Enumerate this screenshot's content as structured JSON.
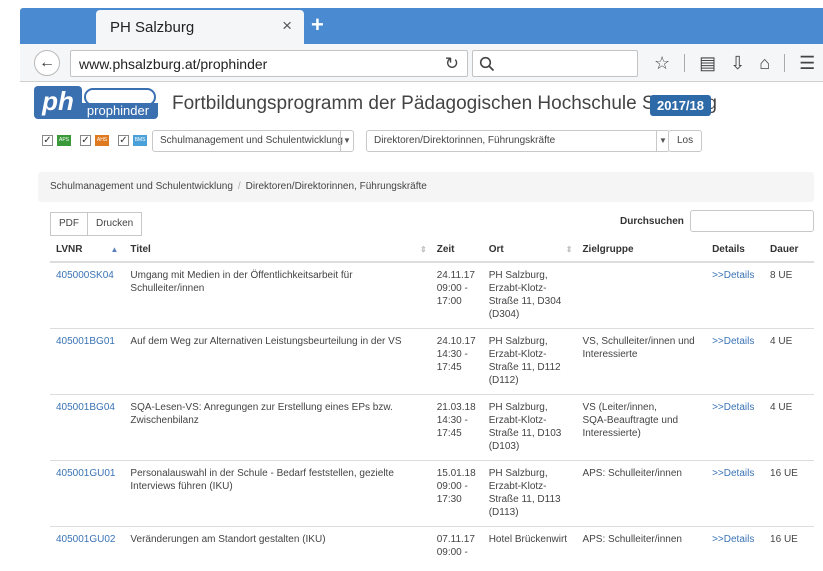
{
  "browser": {
    "tab_title": "PH Salzburg",
    "tab_close": "×",
    "new_tab": "+",
    "url": "www.phsalzburg.at/prophinder",
    "icons": [
      "back-arrow-icon",
      "reload-icon",
      "search-icon",
      "star-icon",
      "reader-icon",
      "download-icon",
      "home-icon",
      "menu-icon"
    ]
  },
  "header": {
    "logo_text": "prophinder",
    "logo_letters": "ph",
    "title": "Fortbildungsprogramm der Pädagogischen Hochschule Salzburg",
    "year": "2017/18"
  },
  "filters": {
    "checkboxes": [
      {
        "checked": "✓",
        "chip_label": "APS",
        "color": "#3a9a3a"
      },
      {
        "checked": "✓",
        "chip_label": "AHS",
        "color": "#e07a20"
      },
      {
        "checked": "✓",
        "chip_label": "BMS",
        "color": "#4aa0d8"
      }
    ],
    "category": "Schulmanagement und Schulentwicklung",
    "audience": "Direktoren/Direktorinnen, Führungskräfte",
    "go_label": "Los"
  },
  "breadcrumb": {
    "items": [
      "Schulmanagement und Schulentwicklung",
      "Direktoren/Direktorinnen, Führungskräfte"
    ],
    "separator": "/"
  },
  "toolbar": {
    "pdf_label": "PDF",
    "print_label": "Drucken",
    "search_label": "Durchsuchen"
  },
  "table": {
    "columns": [
      "LVNR",
      "Titel",
      "Zeit",
      "Ort",
      "Zielgruppe",
      "Details",
      "Dauer"
    ],
    "rows": [
      {
        "lvnr": "405000SK04",
        "titel": "Umgang mit Medien in der Öffentlichkeitsarbeit für Schulleiter/innen",
        "zeit": [
          "24.11.17",
          "09:00 -",
          "17:00"
        ],
        "ort": [
          "PH Salzburg,",
          "Erzabt-Klotz-",
          "Straße 11, D304",
          "(D304)"
        ],
        "zielgruppe": [],
        "details": ">>Details",
        "dauer": "8 UE"
      },
      {
        "lvnr": "405001BG01",
        "titel": "Auf dem Weg zur Alternativen Leistungsbeurteilung in der VS",
        "zeit": [
          "24.10.17",
          "14:30 -",
          "17:45"
        ],
        "ort": [
          "PH Salzburg,",
          "Erzabt-Klotz-",
          "Straße 11, D112",
          "(D112)"
        ],
        "zielgruppe": [
          "VS, Schulleiter/innen und",
          "Interessierte"
        ],
        "details": ">>Details",
        "dauer": "4 UE"
      },
      {
        "lvnr": "405001BG04",
        "titel": "SQA-Lesen-VS: Anregungen zur Erstellung eines EPs bzw. Zwischenbilanz",
        "zeit": [
          "21.03.18",
          "14:30 -",
          "17:45"
        ],
        "ort": [
          "PH Salzburg,",
          "Erzabt-Klotz-",
          "Straße 11, D103",
          "(D103)"
        ],
        "zielgruppe": [
          "VS (Leiter/innen,",
          "SQA-Beauftragte und",
          "Interessierte)"
        ],
        "details": ">>Details",
        "dauer": "4 UE"
      },
      {
        "lvnr": "405001GU01",
        "titel": "Personalauswahl in der Schule - Bedarf feststellen, gezielte Interviews führen (IKU)",
        "zeit": [
          "15.01.18",
          "09:00 -",
          "17:30"
        ],
        "ort": [
          "PH Salzburg,",
          "Erzabt-Klotz-",
          "Straße 11, D113",
          "(D113)"
        ],
        "zielgruppe": [
          "APS: Schulleiter/innen"
        ],
        "details": ">>Details",
        "dauer": "16 UE"
      },
      {
        "lvnr": "405001GU02",
        "titel": "Veränderungen am Standort gestalten (IKU)",
        "zeit": [
          "07.11.17",
          "09:00 -"
        ],
        "ort": [
          "Hotel Brückenwirt"
        ],
        "zielgruppe": [
          "APS: Schulleiter/innen"
        ],
        "details": ">>Details",
        "dauer": "16 UE"
      }
    ]
  }
}
